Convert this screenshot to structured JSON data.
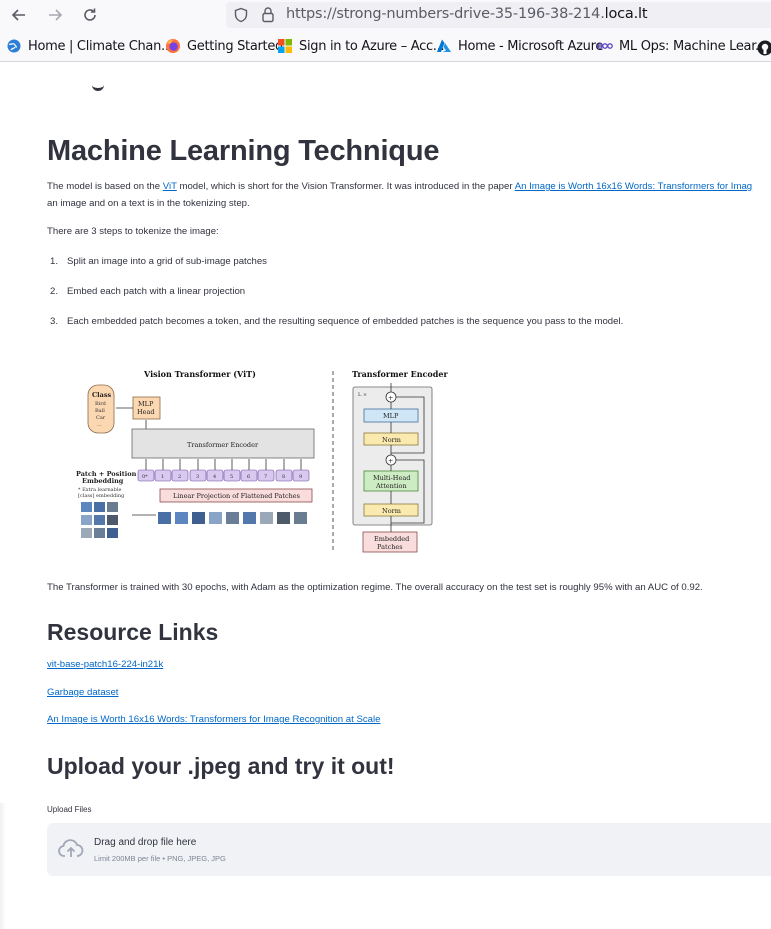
{
  "browser": {
    "url_prefix": "https://strong-numbers-drive-35-196-38-214.",
    "url_host": "loca.lt",
    "bookmarks": [
      {
        "label": "Home | Climate Chan...",
        "icon": "globe-icon"
      },
      {
        "label": "Getting Started",
        "icon": "firefox-icon"
      },
      {
        "label": "Sign in to Azure – Acc...",
        "icon": "microsoft-icon"
      },
      {
        "label": "Home - Microsoft Azure",
        "icon": "azure-icon"
      },
      {
        "label": "ML Ops: Machine Lear...",
        "icon": "link-icon"
      }
    ]
  },
  "page": {
    "title": "Machine Learning Technique",
    "intro_pre": "The model is based on the ",
    "intro_link": "ViT",
    "intro_mid": " model, which is short for the Vision Transformer. It was introduced in the paper ",
    "intro_link2": "An Image is Worth 16x16 Words: Transformers for Imag",
    "intro_line2": "an image and on a text is in the tokenizing step.",
    "steps_intro": "There are 3 steps to tokenize the image:",
    "steps": [
      {
        "num": "1.",
        "text": "Split an image into a grid of sub-image patches"
      },
      {
        "num": "2.",
        "text": "Embed each patch with a linear projection"
      },
      {
        "num": "3.",
        "text": "Each embedded patch becomes a token, and the resulting sequence of embedded patches is the sequence you pass to the model."
      }
    ],
    "figure": {
      "vit_title": "Vision Transformer (ViT)",
      "encoder_title": "Transformer Encoder",
      "class_label": "Class",
      "class_items": [
        "Bird",
        "Ball",
        "Car",
        "..."
      ],
      "mlp_head": [
        "MLP",
        "Head"
      ],
      "transformer_encoder": "Transformer Encoder",
      "patch_pos": [
        "Patch + Position",
        "Embedding"
      ],
      "extra_learnable": [
        "* Extra learnable",
        "[class] embedding"
      ],
      "linear_projection": "Linear Projection of Flattened Patches",
      "lx": "L ×",
      "mlp": "MLP",
      "norm": "Norm",
      "mha": [
        "Multi-Head",
        "Attention"
      ],
      "embedded_patches": [
        "Embedded",
        "Patches"
      ],
      "token_labels": [
        "0*",
        "1",
        "2",
        "3",
        "4",
        "5",
        "6",
        "7",
        "8",
        "9"
      ]
    },
    "training_text": "The Transformer is trained with 30 epochs, with Adam as the optimization regime. The overall accuracy on the test set is roughly 95% with an AUC of 0.92.",
    "resources_title": "Resource Links",
    "links": [
      "vit-base-patch16-224-in21k",
      "Garbage dataset",
      "An Image is Worth 16x16 Words: Transformers for Image Recognition at Scale"
    ],
    "upload_title": "Upload your .jpeg and try it out!",
    "uploader": {
      "label": "Upload Files",
      "main": "Drag and drop file here",
      "sub": "Limit 200MB per file • PNG, JPEG, JPG"
    }
  }
}
